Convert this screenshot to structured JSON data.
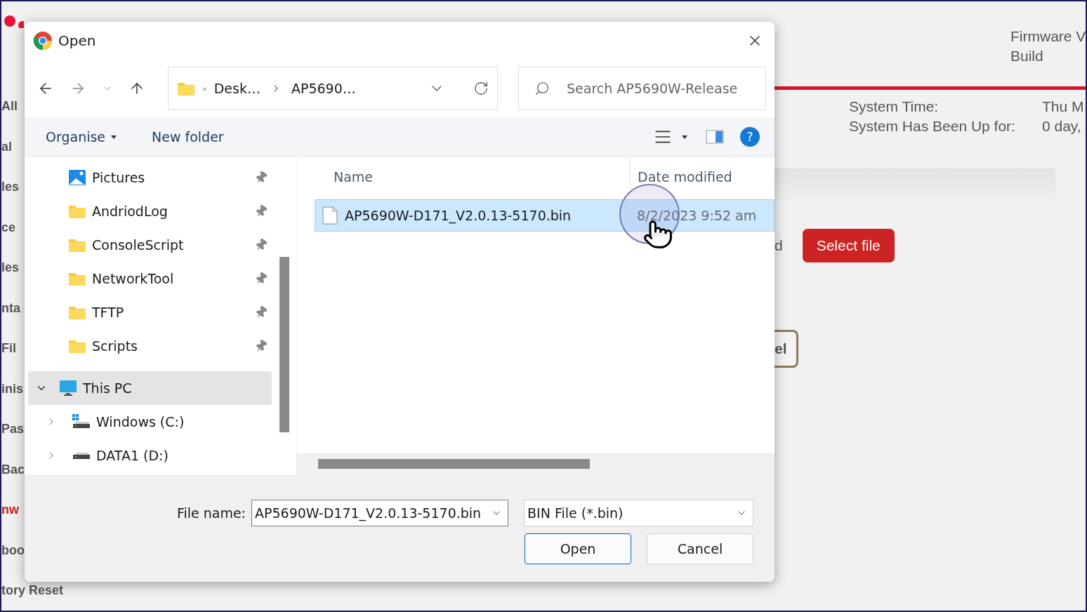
{
  "page": {
    "left_nav": [
      {
        "label": "All",
        "selected": false
      },
      {
        "label": "al",
        "selected": false
      },
      {
        "label": "les",
        "selected": false
      },
      {
        "label": "ce",
        "selected": false
      },
      {
        "label": "les",
        "selected": false
      },
      {
        "label": "nta",
        "selected": false
      },
      {
        "label": "Fil",
        "selected": false
      },
      {
        "label": "inis",
        "selected": false
      },
      {
        "label": "Pas",
        "selected": false
      },
      {
        "label": "Bac",
        "selected": false
      },
      {
        "label": "nw",
        "selected": true
      },
      {
        "label": "boo",
        "selected": false
      },
      {
        "label": "tory Reset",
        "selected": false
      }
    ],
    "header": {
      "firmware_label": "Firmware V",
      "build_label": "Build"
    },
    "system_info": [
      {
        "label": "System Time:",
        "value": "Thu M"
      },
      {
        "label": "System Has Been Up for:",
        "value": "0 day,"
      }
    ],
    "upload_text": "d",
    "select_button": "Select file",
    "cancel_button": "el"
  },
  "dialog": {
    "title": "Open",
    "overflow_marker": "«",
    "help_glyph": "?",
    "breadcrumb": [
      "Desk…",
      "AP5690…"
    ],
    "search": {
      "placeholder": "Search AP5690W-Release"
    },
    "toolbar": [
      "Organise",
      "New folder"
    ],
    "quick_access": [
      {
        "label": "Pictures",
        "kind": "pictures",
        "pinned": true
      },
      {
        "label": "AndriodLog",
        "kind": "folder",
        "pinned": true
      },
      {
        "label": "ConsoleScript",
        "kind": "folder",
        "pinned": true
      },
      {
        "label": "NetworkTool",
        "kind": "folder",
        "pinned": true
      },
      {
        "label": "TFTP",
        "kind": "folder",
        "pinned": true
      },
      {
        "label": "Scripts",
        "kind": "folder",
        "pinned": true
      }
    ],
    "this_pc": {
      "label": "This PC",
      "expanded": true,
      "selected": true,
      "children": [
        {
          "label": "Windows (C:)",
          "kind": "system-drive",
          "expanded": false
        },
        {
          "label": "DATA1 (D:)",
          "kind": "drive",
          "expanded": false
        }
      ]
    },
    "columns": [
      "Name",
      "Date modified"
    ],
    "files": [
      {
        "name": "AP5690W-D171_V2.0.13-5170.bin",
        "date": "8/2/2023 9:52 am",
        "selected": true
      }
    ],
    "file_name_label": "File name:",
    "file_name": "AP5690W-D171_V2.0.13-5170.bin",
    "file_type": "BIN File (*.bin)",
    "buttons": [
      {
        "label": "Open",
        "kind": "primary"
      },
      {
        "label": "Cancel",
        "kind": "secondary"
      }
    ]
  }
}
